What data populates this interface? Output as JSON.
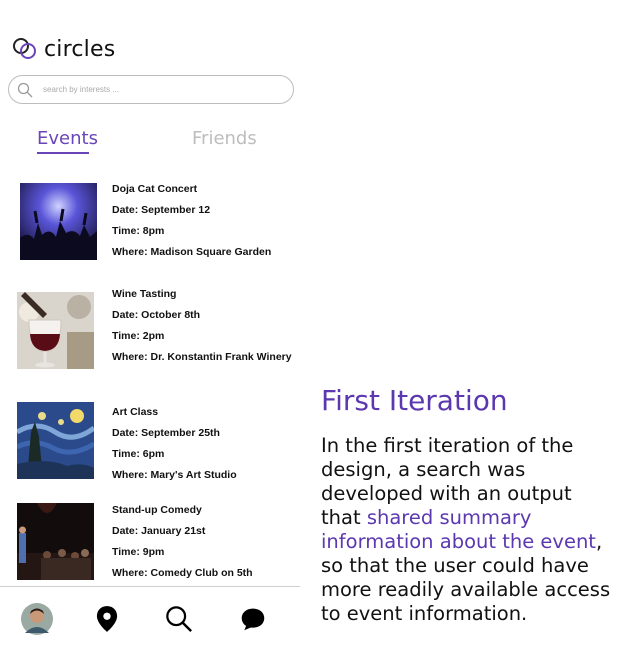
{
  "app": {
    "name": "circles"
  },
  "search": {
    "placeholder": "search by interests ..."
  },
  "tabs": [
    {
      "label": "Events",
      "active": true
    },
    {
      "label": "Friends",
      "active": false
    }
  ],
  "events": [
    {
      "title": "Doja Cat Concert",
      "date": "Date: September 12",
      "time": "Time: 8pm",
      "where": "Where: Madison Square Garden"
    },
    {
      "title": "Wine Tasting",
      "date": "Date: October 8th",
      "time": "Time: 2pm",
      "where": "Where: Dr. Konstantin Frank Winery"
    },
    {
      "title": "Art Class",
      "date": "Date: September 25th",
      "time": "Time: 6pm",
      "where": "Where: Mary's Art Studio"
    },
    {
      "title": "Stand-up Comedy",
      "date": "Date: January 21st",
      "time": "Time: 9pm",
      "where": "Where: Comedy Club on 5th"
    }
  ],
  "bottom_nav": [
    "avatar",
    "location-pin-icon",
    "search-icon",
    "chat-bubble-icon"
  ],
  "panel": {
    "title": "First Iteration",
    "body_before": "In the first iteration of the design, a search was developed with an output that ",
    "body_highlight": "shared summary information about the event",
    "body_after": ", so that the user could have more readily available access to event information."
  },
  "colors": {
    "accent": "#5b38b0",
    "tab_active": "#6a45b8",
    "tab_inactive": "#bdbdbd"
  }
}
